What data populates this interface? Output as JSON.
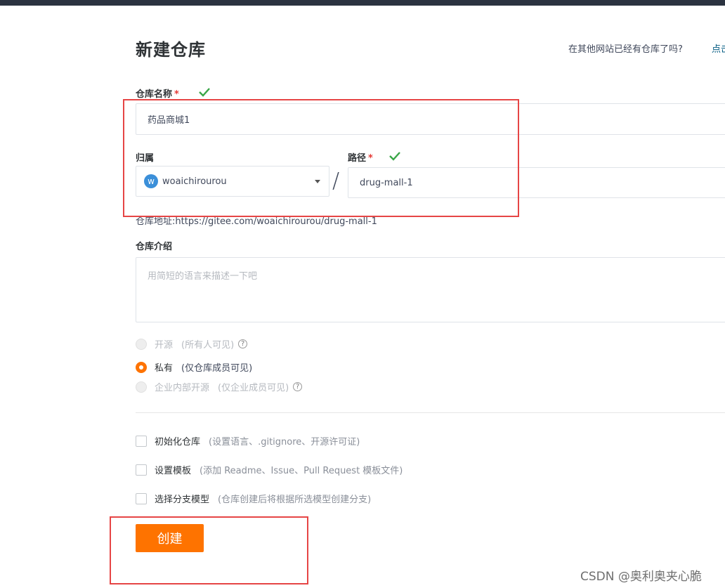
{
  "page": {
    "title": "新建仓库",
    "import_hint": "在其他网站已经有仓库了吗?",
    "import_link": "点击"
  },
  "repo_name": {
    "label": "仓库名称",
    "required_mark": "*",
    "value": "药品商城1"
  },
  "owner": {
    "label": "归属",
    "avatar_letter": "w",
    "value": "woaichirourou"
  },
  "path": {
    "separator": "/",
    "label": "路径",
    "required_mark": "*",
    "value": "drug-mall-1"
  },
  "repo_url": "仓库地址:https://gitee.com/woaichirourou/drug-mall-1",
  "description": {
    "label": "仓库介绍",
    "placeholder": "用简短的语言来描述一下吧"
  },
  "visibility": [
    {
      "label": "开源",
      "hint": "(所有人可见)",
      "selected": false,
      "disabled": true,
      "help": "?"
    },
    {
      "label": "私有",
      "hint": "(仅仓库成员可见)",
      "selected": true,
      "disabled": false
    },
    {
      "label": "企业内部开源",
      "hint": "(仅企业成员可见)",
      "selected": false,
      "disabled": true,
      "help": "?"
    }
  ],
  "options": [
    {
      "label": "初始化仓库",
      "hint": "(设置语言、.gitignore、开源许可证)"
    },
    {
      "label": "设置模板",
      "hint": "(添加 Readme、Issue、Pull Request 模板文件)"
    },
    {
      "label": "选择分支模型",
      "hint": "(仓库创建后将根据所选模型创建分支)"
    }
  ],
  "submit_label": "创建",
  "watermark": "CSDN @奥利奥夹心脆",
  "colors": {
    "accent": "#fe7300",
    "annotation": "#e64545",
    "check": "#3aa648"
  }
}
